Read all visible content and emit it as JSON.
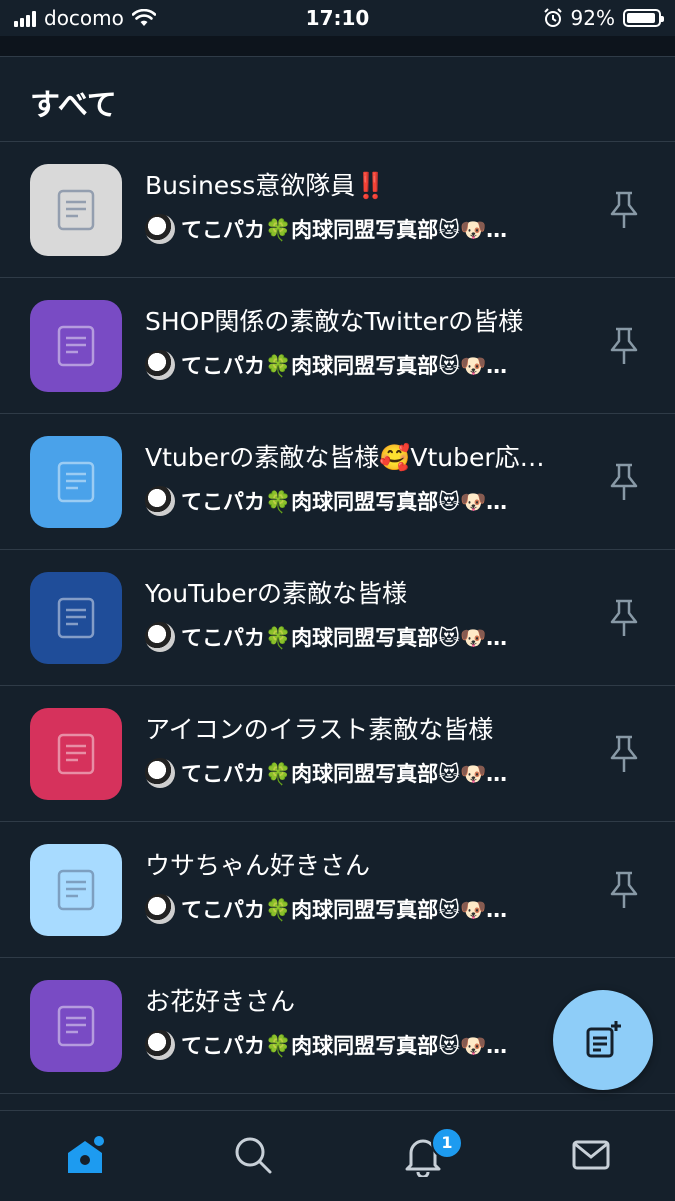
{
  "status_bar": {
    "carrier": "docomo",
    "time": "17:10",
    "battery": "92%",
    "battery_level": 0.92
  },
  "section": {
    "title": "すべて"
  },
  "lists": [
    {
      "title": "Business意欲隊員‼️",
      "owner": "てこパカ🍀肉球同盟写真部😻🐶…",
      "color": "#d9d9d9"
    },
    {
      "title": "SHOP関係の素敵なTwitterの皆様",
      "owner": "てこパカ🍀肉球同盟写真部😻🐶…",
      "color": "#794bc4"
    },
    {
      "title": "Vtuberの素敵な皆様🥰Vtuber応…",
      "owner": "てこパカ🍀肉球同盟写真部😻🐶…",
      "color": "#4aa2ea"
    },
    {
      "title": "YouTuberの素敵な皆様",
      "owner": "てこパカ🍀肉球同盟写真部😻🐶…",
      "color": "#1f4d99"
    },
    {
      "title": "アイコンのイラスト素敵な皆様",
      "owner": "てこパカ🍀肉球同盟写真部😻🐶…",
      "color": "#d6325c"
    },
    {
      "title": "ウサちゃん好きさん",
      "owner": "てこパカ🍀肉球同盟写真部😻🐶…",
      "color": "#a8dbff"
    },
    {
      "title": "お花好きさん",
      "owner": "てこパカ🍀肉球同盟写真部😻🐶…",
      "color": "#794bc4"
    }
  ],
  "tabbar": {
    "home_icon": "home-icon",
    "search_icon": "search-icon",
    "notifications_icon": "bell-icon",
    "notifications_badge": "1",
    "messages_icon": "mail-icon"
  },
  "fab": {
    "icon": "new-list-icon"
  },
  "colors": {
    "background": "#15202b",
    "accent": "#1d9bf0",
    "fab": "#8ecdf8"
  }
}
